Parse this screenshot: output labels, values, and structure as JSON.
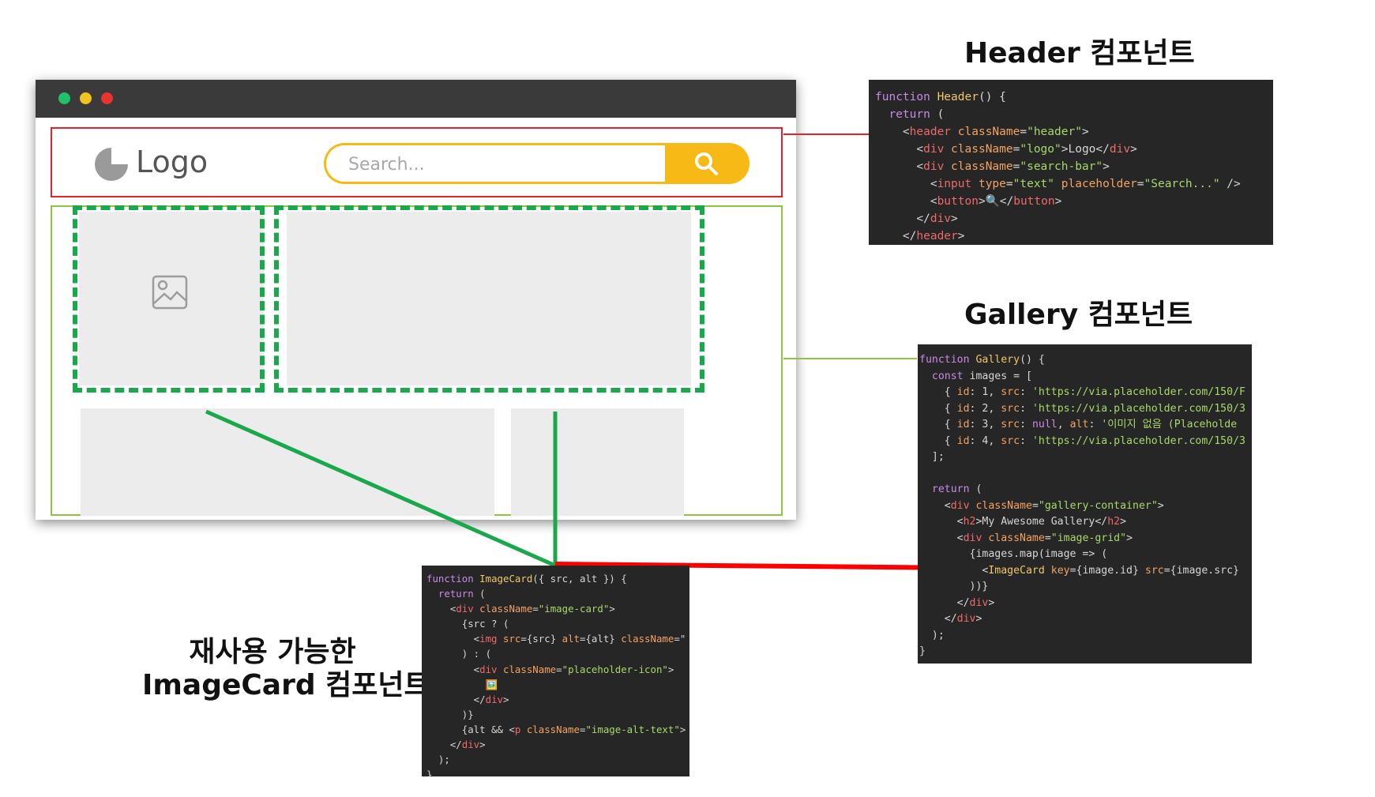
{
  "mockup": {
    "logo_text": "Logo",
    "search_placeholder": "Search..."
  },
  "headings": {
    "header": "Header 컴포넌트",
    "gallery": "Gallery 컴포넌트",
    "imagecard_line1": "재사용 가능한",
    "imagecard_line2": "ImageCard 컴포넌트"
  },
  "code_header": [
    "function Header() {",
    "  return (",
    "    <header className=\"header\">",
    "      <div className=\"logo\">Logo</div>",
    "      <div className=\"search-bar\">",
    "        <input type=\"text\" placeholder=\"Search...\" />",
    "        <button>🔍</button>",
    "      </div>",
    "    </header>"
  ],
  "code_gallery": [
    "function Gallery() {",
    "  const images = [",
    "    { id: 1, src: 'https://via.placeholder.com/150/F",
    "    { id: 2, src: 'https://via.placeholder.com/150/3",
    "    { id: 3, src: null, alt: '이미지 없음 (Placeholde",
    "    { id: 4, src: 'https://via.placeholder.com/150/3",
    "  ];",
    "",
    "  return (",
    "    <div className=\"gallery-container\">",
    "      <h2>My Awesome Gallery</h2>",
    "      <div className=\"image-grid\">",
    "        {images.map(image => (",
    "          <ImageCard key={image.id} src={image.src}",
    "        ))}",
    "      </div>",
    "    </div>",
    "  );",
    "}"
  ],
  "code_imagecard": [
    "function ImageCard({ src, alt }) {",
    "  return (",
    "    <div className=\"image-card\">",
    "      {src ? (",
    "        <img src={src} alt={alt} className=\"",
    "      ) : (",
    "        <div className=\"placeholder-icon\">",
    "          🖼️",
    "        </div>",
    "      )}",
    "      {alt && <p className=\"image-alt-text\">",
    "    </div>",
    "  );",
    "}"
  ],
  "colors": {
    "header_outline": "#e8202a",
    "gallery_outline": "#8cc63f",
    "imagecard_dash": "#1aa84c",
    "arrow": "#ff0000",
    "search_accent": "#f6b915",
    "code_bg": "#262626"
  },
  "icons": [
    "search-icon",
    "image-placeholder-icon",
    "logo-icon"
  ]
}
